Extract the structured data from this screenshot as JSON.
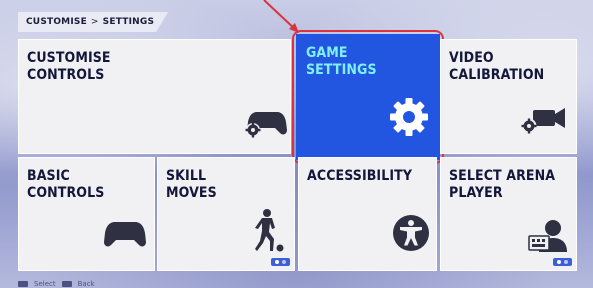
{
  "breadcrumb": {
    "parent": "CUSTOMISE",
    "separator": ">",
    "current": "SETTINGS"
  },
  "tiles": {
    "customise_controls": {
      "label": "CUSTOMISE\nCONTROLS",
      "icon": "gamepad-gear-icon"
    },
    "game_settings": {
      "label": "GAME\nSETTINGS",
      "icon": "gear-icon"
    },
    "video_calibration": {
      "label": "VIDEO\nCALIBRATION",
      "icon": "camera-gear-icon"
    },
    "basic_controls": {
      "label": "BASIC\nCONTROLS",
      "icon": "gamepad-icon"
    },
    "skill_moves": {
      "label": "SKILL\nMOVES",
      "icon": "footballer-icon"
    },
    "accessibility": {
      "label": "ACCESSIBILITY",
      "icon": "accessibility-icon"
    },
    "select_arena_player": {
      "label": "SELECT ARENA\nPLAYER",
      "icon": "player-select-icon"
    }
  },
  "footer": {
    "select_label": "Select",
    "back_label": "Back"
  },
  "colors": {
    "tile_bg": "#f1f1f4",
    "selected_tile_bg": "#2356e0",
    "selected_label": "#7ff0f5",
    "label_text": "#13173a",
    "highlight_border": "#d8333e"
  }
}
